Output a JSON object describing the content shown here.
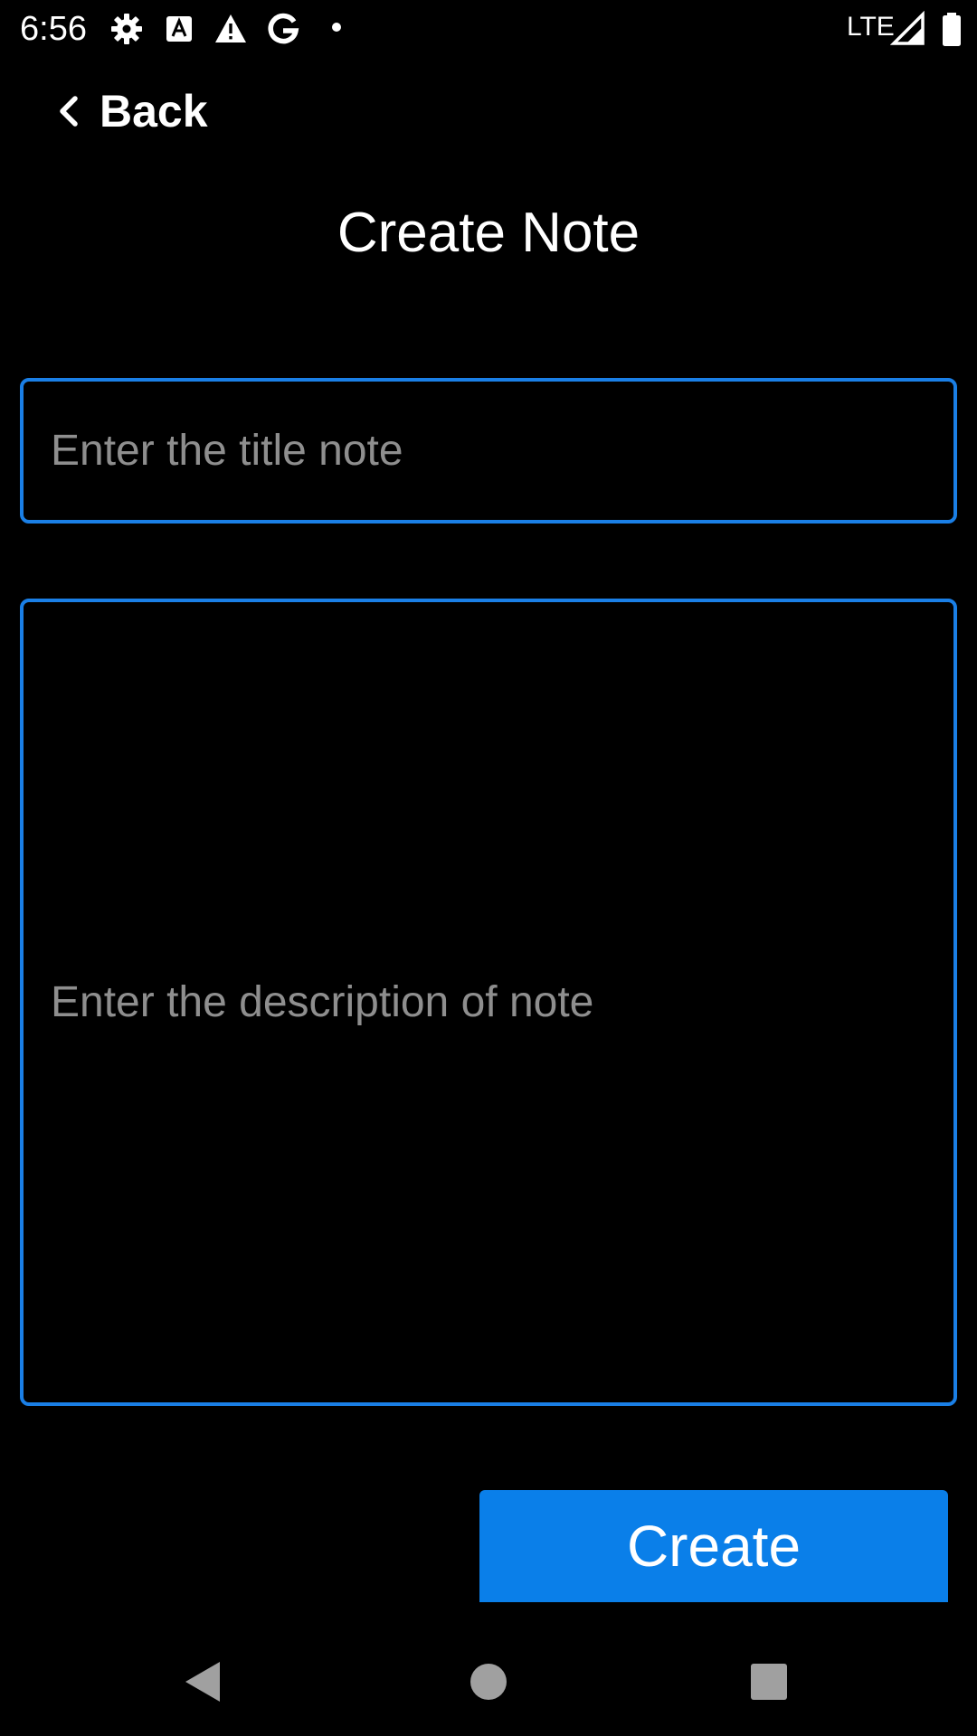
{
  "status_bar": {
    "time": "6:56",
    "network": "LTE",
    "icons": [
      "gear-icon",
      "font-a-icon",
      "warning-icon",
      "google-g-icon",
      "dot-icon",
      "signal-icon",
      "battery-icon"
    ]
  },
  "header": {
    "back_label": "Back",
    "title": "Create Note"
  },
  "form": {
    "title_placeholder": "Enter the title note",
    "title_value": "",
    "description_placeholder": "Enter the description of note",
    "description_value": ""
  },
  "actions": {
    "create_label": "Create"
  },
  "colors": {
    "background": "#000000",
    "accent": "#0a7fe9",
    "border": "#1a7fe6",
    "placeholder": "#8e8e8e",
    "nav_gray": "#a0a0a0"
  },
  "nav_bar": {
    "icons": [
      "back-triangle-icon",
      "home-circle-icon",
      "recents-square-icon"
    ]
  }
}
